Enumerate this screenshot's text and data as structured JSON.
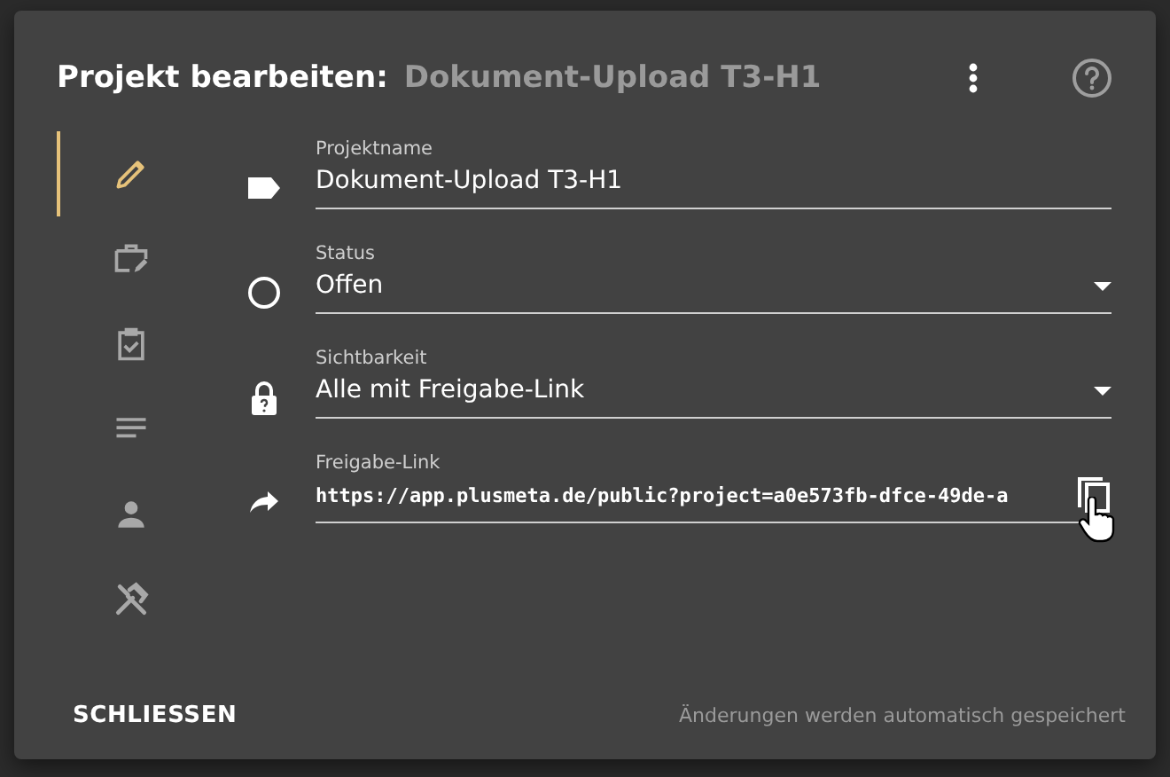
{
  "dialog": {
    "title": "Projekt bearbeiten:",
    "subtitle": "Dokument-Upload T3-H1"
  },
  "tabs": [
    {
      "selected": true
    },
    {
      "selected": false
    },
    {
      "selected": false
    },
    {
      "selected": false
    },
    {
      "selected": false
    },
    {
      "selected": false
    }
  ],
  "fields": [
    {
      "kind": "text",
      "label": "Projektname",
      "value": "Dokument-Upload T3-H1"
    },
    {
      "kind": "select",
      "label": "Status",
      "value": "Offen"
    },
    {
      "kind": "select",
      "label": "Sichtbarkeit",
      "value": "Alle mit Freigabe-Link"
    },
    {
      "kind": "link",
      "label": "Freigabe-Link",
      "value": "https://app.plusmeta.de/public?project=a0e573fb-dfce-49de-a"
    }
  ],
  "footer": {
    "close_button": "SCHLIESSEN",
    "note": "Änderungen werden automatisch gespeichert"
  }
}
